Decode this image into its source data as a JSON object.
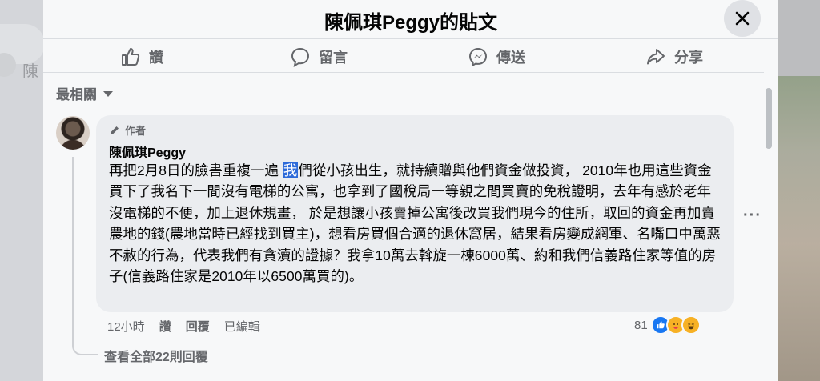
{
  "background": {
    "search_placeholder": "陳"
  },
  "modal": {
    "title": "陳佩琪Peggy的貼文",
    "close_label": "Close"
  },
  "actions": [
    {
      "label": "讚",
      "icon": "like-icon"
    },
    {
      "label": "留言",
      "icon": "comment-icon"
    },
    {
      "label": "傳送",
      "icon": "messenger-icon"
    },
    {
      "label": "分享",
      "icon": "share-icon"
    }
  ],
  "sort": {
    "label": "最相關"
  },
  "comment": {
    "badge": "作者",
    "author": "陳佩琪Peggy",
    "text_before": "再把2月8日的臉書重複一遍 ",
    "text_highlight": "我",
    "text_after": "們從小孩出生，就持續贈與他們資金做投資， 2010年也用這些資金買下了我名下一間沒有電梯的公寓，也拿到了國稅局一等親之間買賣的免稅證明，去年有感於老年沒電梯的不便，加上退休規畫， 於是想讓小孩賣掉公寓後改買我們現今的住所，取回的資金再加賣農地的錢(農地當時已經找到買主)，想看房買個合適的退休窩居，結果看房變成網軍、名嘴口中萬惡不赦的行為，代表我們有貪瀆的證據？我拿10萬去斡旋一棟6000萬、約和我們信義路住家等值的房子(信義路住家是2010年以6500萬買的)。",
    "time": "12小時",
    "like_label": "讚",
    "reply_label": "回覆",
    "edited_label": "已編輯",
    "reaction_count": "81",
    "reactions": [
      "like",
      "care",
      "haha"
    ],
    "view_replies": "查看全部22則回覆"
  },
  "colors": {
    "accent": "#1877f2",
    "highlight": "#2d6ad9",
    "bubble": "#ebedf0",
    "muted_text": "#65676b"
  }
}
